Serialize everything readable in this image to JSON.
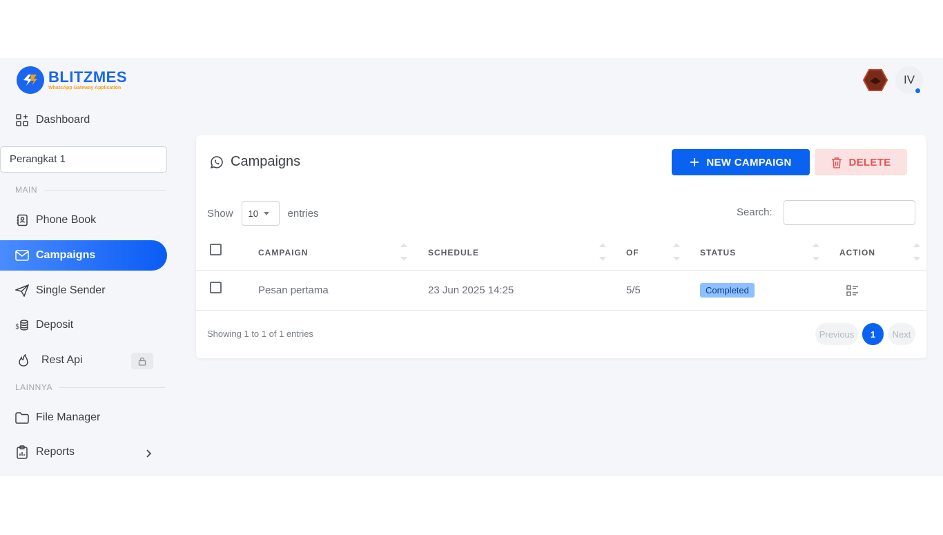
{
  "brand": {
    "name": "BLITZMES",
    "tagline": "WhatsApp Gateway Application",
    "color": "#1a66f0"
  },
  "sidebar": {
    "dashboard": "Dashboard",
    "device": "Perangkat 1",
    "section_main": "MAIN",
    "section_other": "LAINNYA",
    "items": [
      {
        "label": "Phone Book",
        "icon": "contact-book-icon"
      },
      {
        "label": "Campaigns",
        "icon": "mail-icon",
        "active": true
      },
      {
        "label": "Single Sender",
        "icon": "send-icon"
      },
      {
        "label": "Deposit",
        "icon": "coins-icon"
      },
      {
        "label": "Rest Api",
        "icon": "fire-icon",
        "locked": true
      },
      {
        "label": "File Manager",
        "icon": "folder-icon"
      },
      {
        "label": "Reports",
        "icon": "clipboard-icon",
        "expandable": true
      }
    ]
  },
  "user": {
    "initials": "IV"
  },
  "page": {
    "title": "Campaigns",
    "new_button": "NEW CAMPAIGN",
    "delete_button": "DELETE",
    "show_label": "Show",
    "entries_value": "10",
    "entries_label": "entries",
    "search_label": "Search:",
    "search_value": ""
  },
  "table": {
    "columns": [
      "CAMPAIGN",
      "SCHEDULE",
      "OF",
      "STATUS",
      "ACTION"
    ],
    "rows": [
      {
        "campaign": "Pesan pertama",
        "schedule": "23 Jun 2025 14:25",
        "of": "5/5",
        "status": "Completed"
      }
    ],
    "info": "Showing 1 to 1 of 1 entries",
    "pagination": {
      "previous": "Previous",
      "current": "1",
      "next": "Next"
    }
  },
  "colors": {
    "primary": "#0a63f0",
    "danger": "#e05555",
    "status_completed": "#8ec0ff"
  }
}
